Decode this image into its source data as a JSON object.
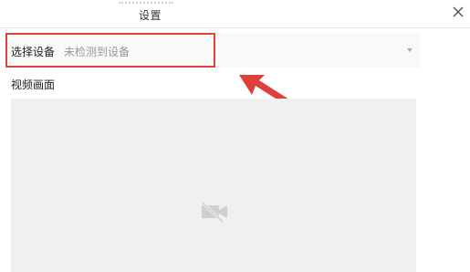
{
  "dialog": {
    "title": "设置",
    "close_icon": "close-icon"
  },
  "device": {
    "label": "选择设备",
    "value": "未检测到设备",
    "caret_icon": "caret-down-icon"
  },
  "video": {
    "label": "视频画面",
    "icon": "camera-off-icon"
  },
  "colors": {
    "highlight": "#e0403c",
    "video_bg": "#f0f0f0",
    "placeholder_text": "#999999"
  }
}
